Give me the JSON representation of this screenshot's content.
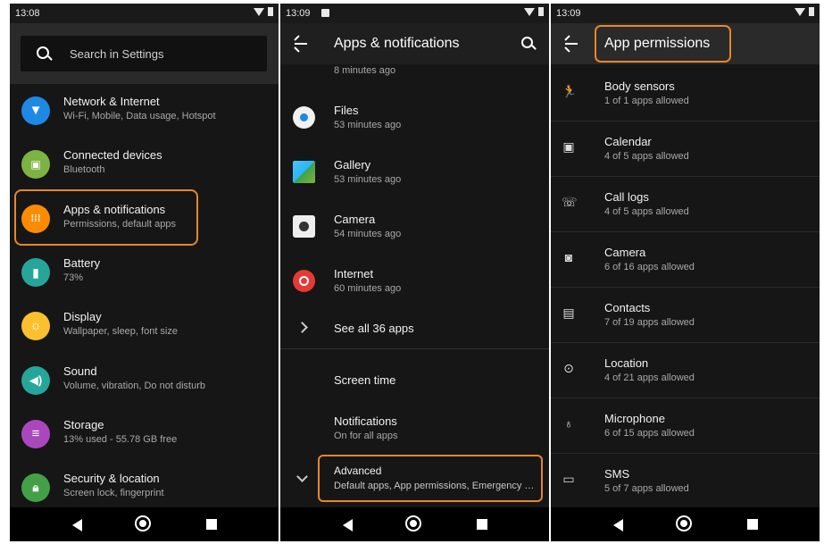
{
  "left_panel": {
    "status_time": "13:08",
    "search_placeholder": "Search in Settings",
    "items": [
      {
        "title": "Network & Internet",
        "subtitle": "Wi-Fi, Mobile, Data usage, Hotspot",
        "icon": "wifi-icon",
        "color": "#1e88e5"
      },
      {
        "title": "Connected devices",
        "subtitle": "Bluetooth",
        "icon": "devices-icon",
        "color": "#7cb342"
      },
      {
        "title": "Apps & notifications",
        "subtitle": "Permissions, default apps",
        "icon": "apps-icon",
        "color": "#fb8c00"
      },
      {
        "title": "Battery",
        "subtitle": "73%",
        "icon": "battery-icon",
        "color": "#26a69a"
      },
      {
        "title": "Display",
        "subtitle": "Wallpaper, sleep, font size",
        "icon": "brightness-icon",
        "color": "#fb8c00"
      },
      {
        "title": "Sound",
        "subtitle": "Volume, vibration, Do not disturb",
        "icon": "volume-icon",
        "color": "#26a69a"
      },
      {
        "title": "Storage",
        "subtitle": "13% used - 55.78 GB free",
        "icon": "storage-icon",
        "color": "#ab47bc"
      },
      {
        "title": "Security & location",
        "subtitle": "Screen lock, fingerprint",
        "icon": "lock-icon",
        "color": "#43a047"
      }
    ]
  },
  "middle_panel": {
    "status_time": "13:09",
    "title": "Apps & notifications",
    "partial_item_subtitle": "8 minutes ago",
    "apps": [
      {
        "title": "Files",
        "subtitle": "53 minutes ago",
        "icon": "files-icon"
      },
      {
        "title": "Gallery",
        "subtitle": "53 minutes ago",
        "icon": "gallery-icon"
      },
      {
        "title": "Camera",
        "subtitle": "54 minutes ago",
        "icon": "camera-app-icon"
      },
      {
        "title": "Internet",
        "subtitle": "60 minutes ago",
        "icon": "internet-icon"
      }
    ],
    "see_all": "See all 36 apps",
    "screen_time": "Screen time",
    "notifications": {
      "title": "Notifications",
      "subtitle": "On for all apps"
    },
    "advanced": {
      "title": "Advanced",
      "subtitle": "Default apps, App permissions, Emergency alerts"
    }
  },
  "right_panel": {
    "status_time": "13:09",
    "title": "App permissions",
    "permissions": [
      {
        "title": "Body sensors",
        "subtitle": "1 of 1 apps allowed",
        "icon": "body-sensors-icon",
        "glyph": "🏃"
      },
      {
        "title": "Calendar",
        "subtitle": "4 of 5 apps allowed",
        "icon": "calendar-icon",
        "glyph": "▣"
      },
      {
        "title": "Call logs",
        "subtitle": "4 of 5 apps allowed",
        "icon": "call-log-icon",
        "glyph": "☏"
      },
      {
        "title": "Camera",
        "subtitle": "6 of 16 apps allowed",
        "icon": "camera-icon",
        "glyph": "◙"
      },
      {
        "title": "Contacts",
        "subtitle": "7 of 19 apps allowed",
        "icon": "contacts-icon",
        "glyph": "▤"
      },
      {
        "title": "Location",
        "subtitle": "4 of 21 apps allowed",
        "icon": "location-icon",
        "glyph": "⊙"
      },
      {
        "title": "Microphone",
        "subtitle": "6 of 15 apps allowed",
        "icon": "microphone-icon",
        "glyph": "♁"
      },
      {
        "title": "SMS",
        "subtitle": "5 of 7 apps allowed",
        "icon": "sms-icon",
        "glyph": "▭"
      }
    ]
  },
  "colors": {
    "highlight": "#e8862a",
    "background": "#161616"
  }
}
